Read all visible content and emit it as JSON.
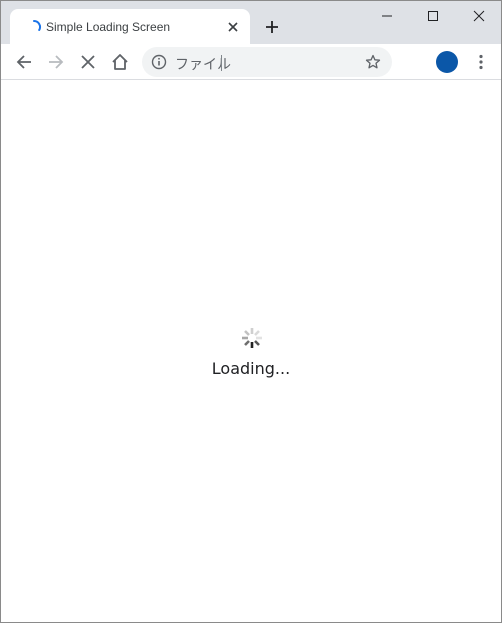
{
  "browser": {
    "tab": {
      "title": "Simple Loading Screen"
    },
    "address_bar": {
      "value": "ファイル"
    }
  },
  "colors": {
    "tab_strip": "#dee1e6",
    "spinner_accent": "#1a73e8",
    "avatar": "#0b57a8"
  },
  "icons": {
    "tab": [
      "loading-spinner-icon",
      "close-icon"
    ],
    "window": [
      "minimize-icon",
      "maximize-icon",
      "close-window-icon"
    ],
    "toolbar": [
      "back-arrow-icon",
      "forward-arrow-icon",
      "stop-icon",
      "home-icon",
      "info-icon",
      "star-icon",
      "kebab-menu-icon"
    ]
  },
  "page": {
    "loading_text": "Loading..."
  }
}
